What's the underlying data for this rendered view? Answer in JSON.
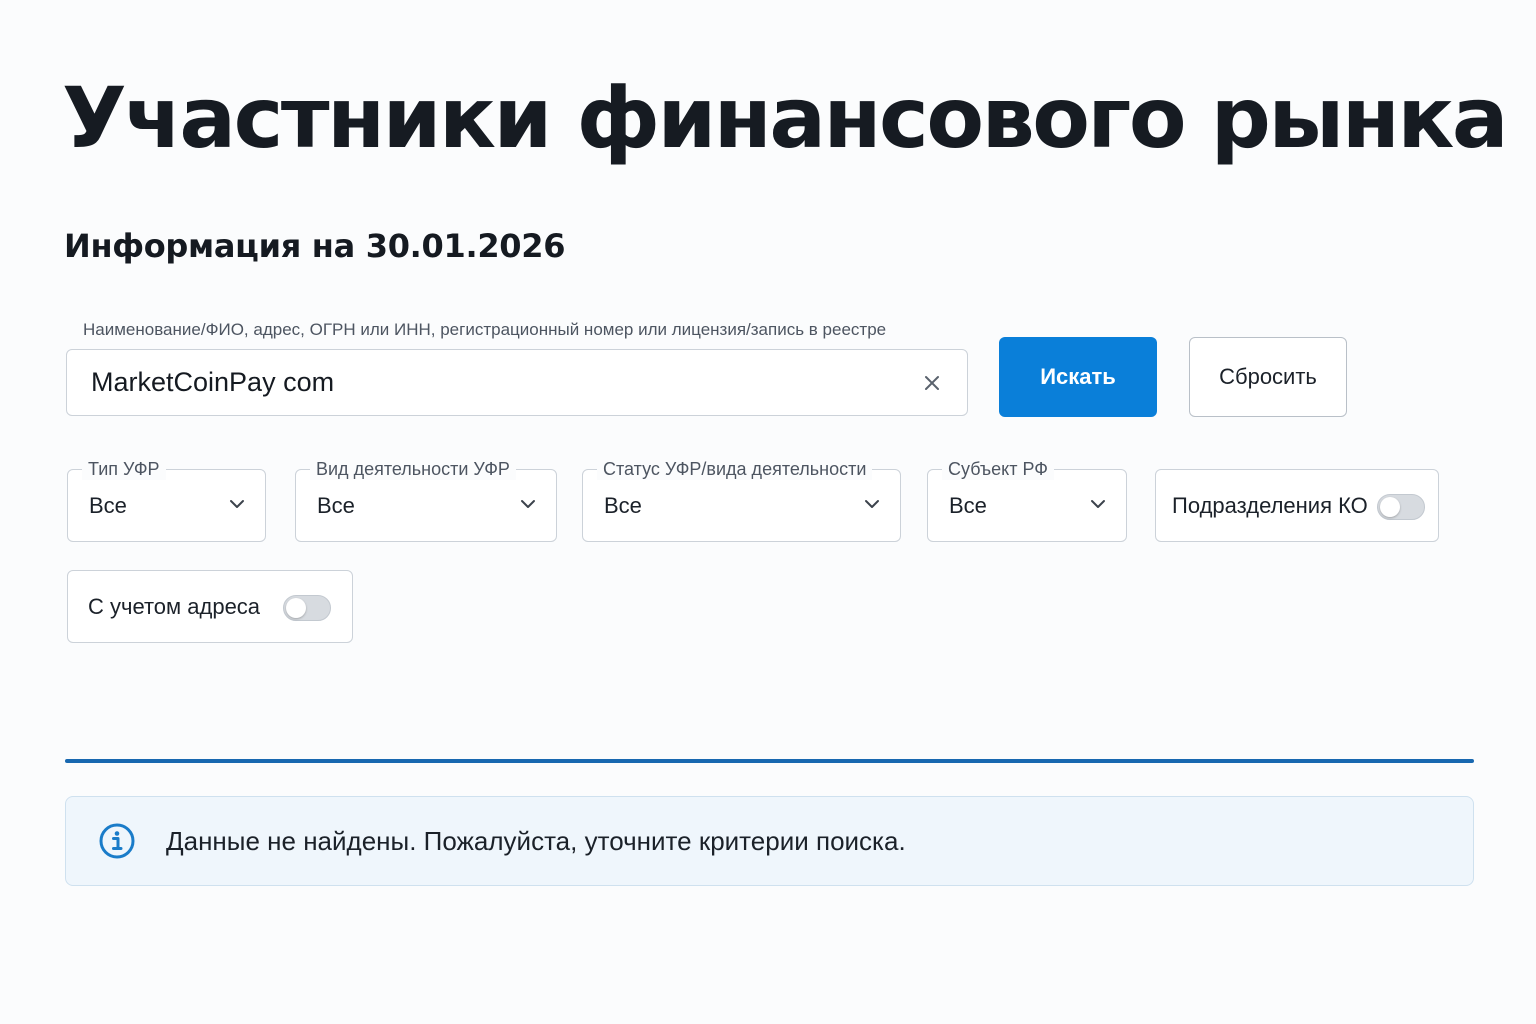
{
  "page": {
    "title": "Участники финансового рынка",
    "info_date": "Информация на 30.01.2026"
  },
  "search": {
    "label": "Наименование/ФИО, адрес, ОГРН или ИНН, регистрационный номер или лицензия/запись в реестре",
    "value": "MarketCoinPay com",
    "clear_icon": "close-icon"
  },
  "buttons": {
    "search_label": "Искать",
    "reset_label": "Сбросить",
    "accent_color": "#0a7fd9"
  },
  "filters": [
    {
      "label": "Тип УФР",
      "value": "Все"
    },
    {
      "label": "Вид деятельности УФР",
      "value": "Все"
    },
    {
      "label": "Статус УФР/вида деятельности",
      "value": "Все"
    },
    {
      "label": "Субъект РФ",
      "value": "Все"
    }
  ],
  "toggles": {
    "branches": {
      "label": "Подразделения КО",
      "checked": false
    },
    "with_address": {
      "label": "С учетом адреса",
      "checked": false
    }
  },
  "alert": {
    "icon": "info-icon",
    "text": "Данные не найдены. Пожалуйста, уточните критерии поиска.",
    "color": "#1a7cc9"
  },
  "divider_color": "#1868b0"
}
